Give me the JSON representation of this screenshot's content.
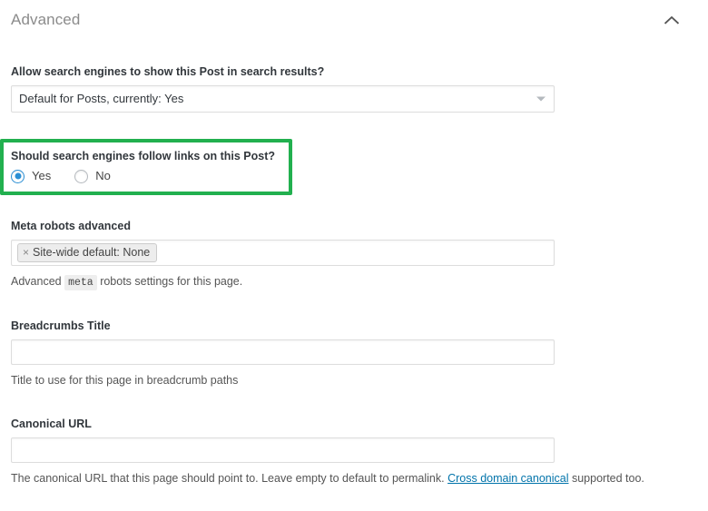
{
  "panel": {
    "title": "Advanced",
    "collapse_icon": "chevron-up-icon"
  },
  "fields": {
    "allow_search_engines": {
      "label": "Allow search engines to show this Post in search results?",
      "selected_option": "Default for Posts, currently: Yes",
      "dropdown_icon": "chevron-down-icon"
    },
    "follow_links": {
      "label": "Should search engines follow links on this Post?",
      "highlighted": true,
      "highlight_color": "#22b04f",
      "options": [
        {
          "label": "Yes",
          "checked": true
        },
        {
          "label": "No",
          "checked": false
        }
      ]
    },
    "meta_robots_advanced": {
      "label": "Meta robots advanced",
      "tokens": [
        {
          "remove_icon": "close-icon",
          "remove_glyph": "×",
          "label": "Site-wide default: None"
        }
      ],
      "help_prefix": "Advanced",
      "help_code": "meta",
      "help_suffix": "robots settings for this page."
    },
    "breadcrumbs_title": {
      "label": "Breadcrumbs Title",
      "value": "",
      "placeholder": "",
      "help": "Title to use for this page in breadcrumb paths"
    },
    "canonical_url": {
      "label": "Canonical URL",
      "value": "",
      "placeholder": "",
      "help_before": "The canonical URL that this page should point to. Leave empty to default to permalink.",
      "help_link": "Cross domain canonical",
      "help_after": "supported too."
    }
  },
  "colors": {
    "highlight_green": "#22b04f",
    "link_blue": "#0073aa",
    "radio_blue": "#2b8fd4",
    "label_text": "#32373c",
    "title_text": "#8b8b8b"
  }
}
